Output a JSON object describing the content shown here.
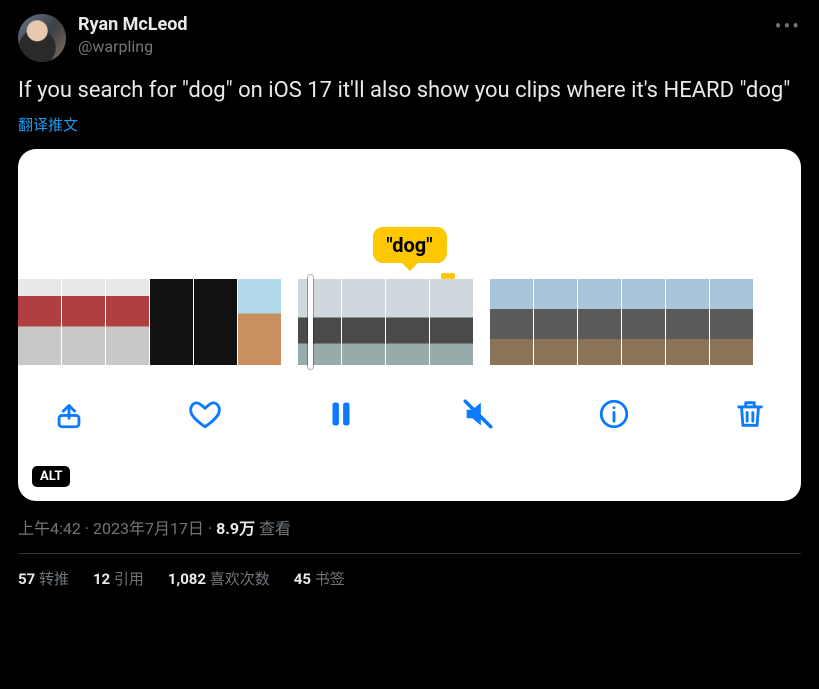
{
  "author": {
    "display_name": "Ryan McLeod",
    "handle": "@warpling"
  },
  "menu_glyph": "•••",
  "content_text": "If you search for \"dog\" on iOS 17 it'll also show you clips where it's HEARD \"dog\"",
  "translate_label": "翻译推文",
  "media": {
    "caption_bubble": "\"dog\"",
    "alt_badge": "ALT",
    "toolbar_icons": {
      "share": "share-icon",
      "like": "heart-icon",
      "pause": "pause-icon",
      "mute": "speaker-muted-icon",
      "info": "info-icon",
      "delete": "trash-icon"
    }
  },
  "meta": {
    "time": "上午4:42",
    "separator1": " · ",
    "date": "2023年7月17日",
    "separator2": " · ",
    "views_count": "8.9万",
    "views_label": " 查看"
  },
  "stats": {
    "retweets_count": "57",
    "retweets_label": " 转推",
    "quotes_count": "12",
    "quotes_label": " 引用",
    "likes_count": "1,082",
    "likes_label": " 喜欢次数",
    "bookmarks_count": "45",
    "bookmarks_label": " 书签"
  }
}
